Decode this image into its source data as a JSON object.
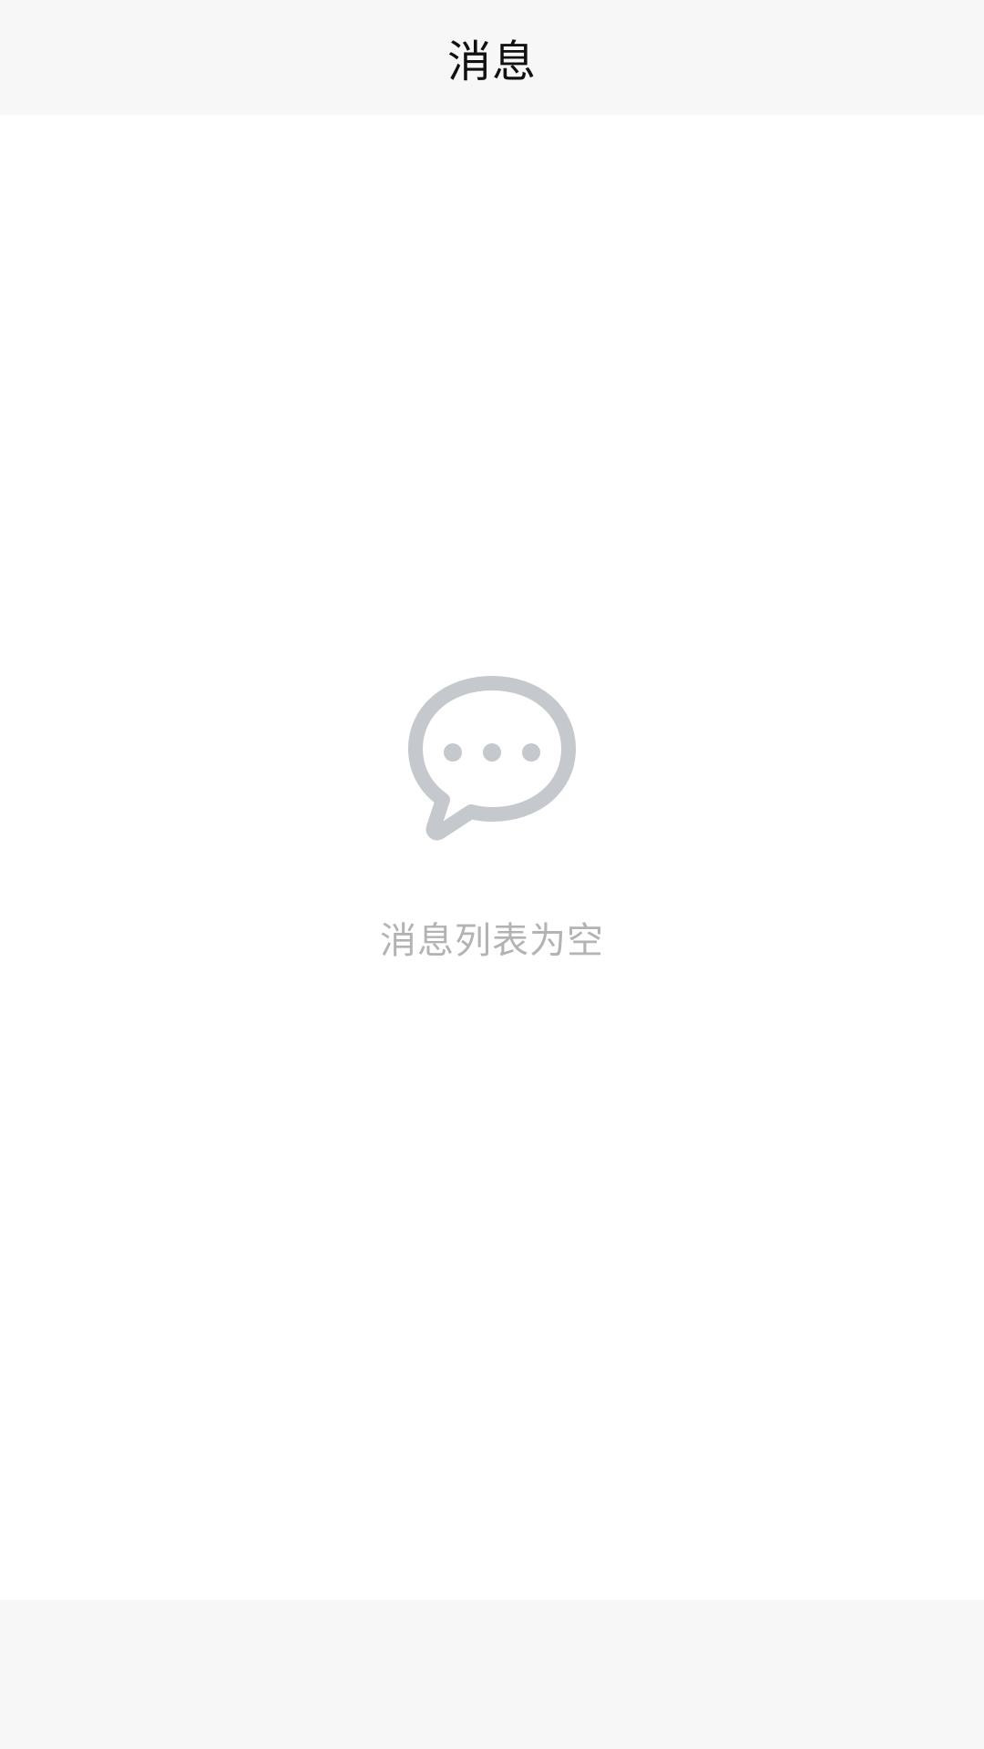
{
  "header": {
    "title": "消息"
  },
  "empty_state": {
    "icon": "chat-bubble-icon",
    "message": "消息列表为空"
  },
  "colors": {
    "header_bg": "#f7f7f7",
    "content_bg": "#ffffff",
    "icon_gray": "#c5c8cc",
    "empty_text": "#b3b3b3",
    "title_text": "#111111"
  }
}
